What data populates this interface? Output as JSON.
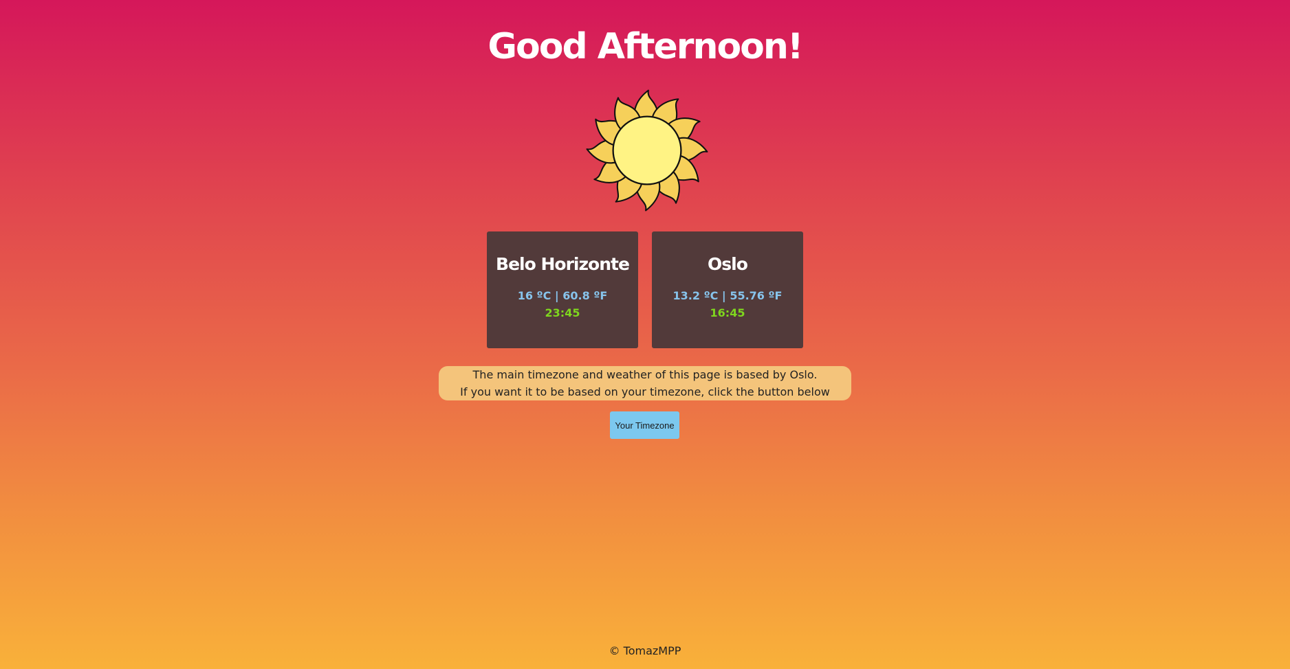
{
  "header": {
    "greeting": "Good Afternoon!"
  },
  "hero": {
    "icon": "sun-icon"
  },
  "cities": [
    {
      "name": "Belo Horizonte",
      "temperature": "16 ºC | 60.8 ºF",
      "time": "23:45"
    },
    {
      "name": "Oslo",
      "temperature": "13.2 ºC | 55.76 ºF",
      "time": "16:45"
    }
  ],
  "info": {
    "line1": "The main timezone and weather of this page is based by Oslo.",
    "line2": "If you want it to be based on your timezone, click the button below"
  },
  "actions": {
    "timezone_button": "Your Timezone"
  },
  "footer": {
    "copyright": "© TomazMPP"
  },
  "colors": {
    "gradient_top": "#d5175a",
    "gradient_bottom": "#f9b13a",
    "card_bg": "#523a3a",
    "temp_text": "#87c4ec",
    "time_text": "#7fd61e",
    "info_bg": "#f4c47b",
    "button_bg": "#7cc8ef",
    "sun_core": "#fff384",
    "sun_petals": "#f6d05a"
  }
}
